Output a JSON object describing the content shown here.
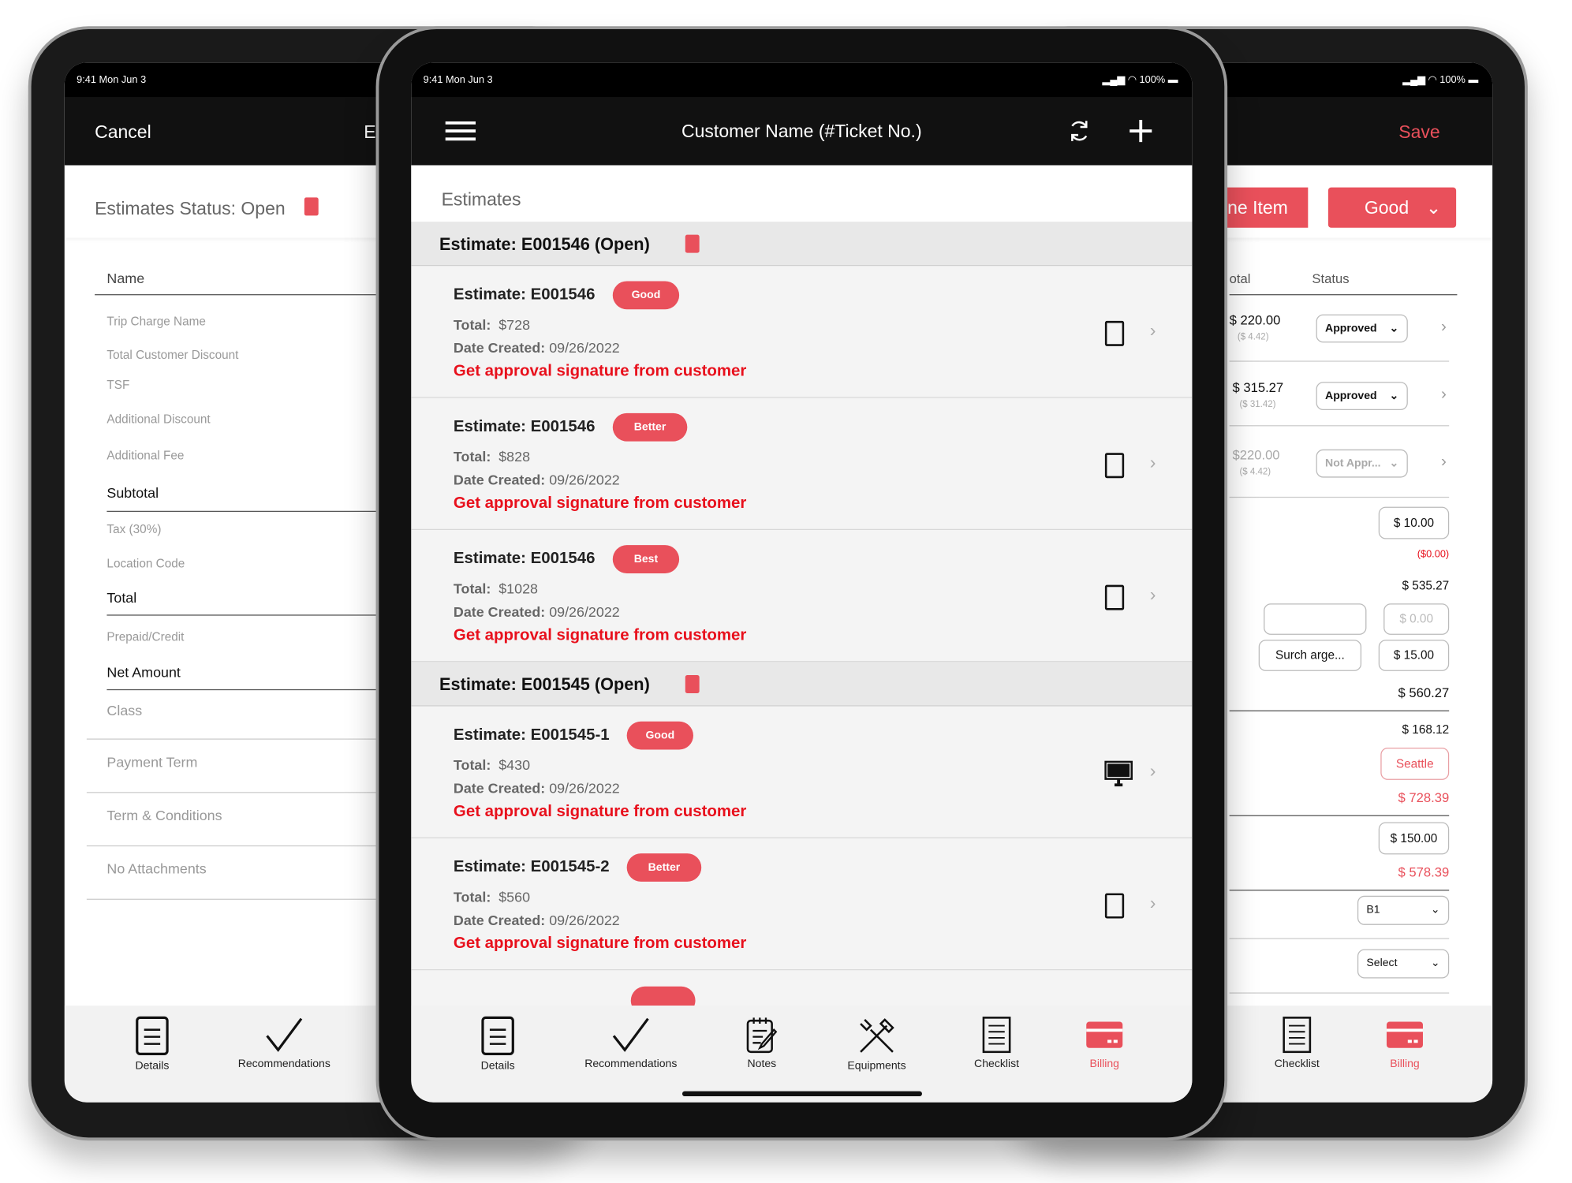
{
  "status_bar": {
    "time": "9:41 Mon Jun 3",
    "battery": "100%"
  },
  "left": {
    "cancel": "Cancel",
    "title_partial": "E",
    "status": "Estimates Status: Open",
    "fields": [
      "Name",
      "Trip Charge Name",
      "Total Customer Discount",
      "TSF",
      "Additional Discount",
      "Additional Fee",
      "Subtotal",
      "Tax (30%)",
      "Location Code",
      "Total",
      "Prepaid/Credit",
      "Net Amount",
      "Class",
      "Payment Term",
      "Term & Conditions",
      "No Attachments"
    ],
    "tabs": [
      "Details",
      "Recommendations"
    ]
  },
  "center": {
    "title": "Customer Name (#Ticket No.)",
    "heading": "Estimates",
    "sections": [
      {
        "title": "Estimate: E001546  (Open)",
        "items": [
          {
            "name": "Estimate: E001546",
            "badge": "Good",
            "total_label": "Total:",
            "total": "$728",
            "date_label": "Date Created:",
            "date": "09/26/2022",
            "action": "Get approval signature from customer",
            "device": "tablet"
          },
          {
            "name": "Estimate: E001546",
            "badge": "Better",
            "total_label": "Total:",
            "total": "$828",
            "date_label": "Date Created:",
            "date": "09/26/2022",
            "action": "Get approval signature from customer",
            "device": "tablet"
          },
          {
            "name": "Estimate: E001546",
            "badge": "Best",
            "total_label": "Total:",
            "total": "$1028",
            "date_label": "Date Created:",
            "date": "09/26/2022",
            "action": "Get approval signature from customer",
            "device": "tablet"
          }
        ]
      },
      {
        "title": "Estimate: E001545  (Open)",
        "items": [
          {
            "name": "Estimate: E001545-1",
            "badge": "Good",
            "total_label": "Total:",
            "total": "$430",
            "date_label": "Date Created:",
            "date": "09/26/2022",
            "action": "Get approval signature from customer",
            "device": "desktop"
          },
          {
            "name": "Estimate: E001545-2",
            "badge": "Better",
            "total_label": "Total:",
            "total": "$560",
            "date_label": "Date Created:",
            "date": "09/26/2022",
            "action": "Get approval signature from customer",
            "device": "tablet"
          }
        ]
      }
    ],
    "tabs": [
      "Details",
      "Recommendations",
      "Notes",
      "Equipments",
      "Checklist",
      "Billing"
    ],
    "active_tab": "Billing"
  },
  "right": {
    "save": "Save",
    "line_item_partial": "ne Item",
    "tier_select": "Good",
    "col_total_partial": "otal",
    "col_status": "Status",
    "rows": [
      {
        "amount": "$ 220.00",
        "tax": "($ 4.42)",
        "status": "Approved"
      },
      {
        "amount": "$ 315.27",
        "tax": "($ 31.42)",
        "status": "Approved"
      },
      {
        "amount": "$220.00",
        "tax": "($ 4.42)",
        "status": "Not Appr..."
      }
    ],
    "values": {
      "fee": "$ 10.00",
      "discount": "($0.00)",
      "subtotal": "$ 535.27",
      "tax_placeholder": "$ 0.00",
      "surcharge": "Surch arge...",
      "surcharge_amount": "$ 15.00",
      "total": "$ 560.27",
      "tax_total": "$ 168.12",
      "location": "Seattle",
      "grand": "$ 728.39",
      "prepaid": "$ 150.00",
      "net": "$ 578.39",
      "class": "B1",
      "payment_term": "Select"
    },
    "tabs": [
      "Checklist",
      "Billing"
    ]
  },
  "colors": {
    "accent": "#e9505b",
    "alert": "#e8101c",
    "nav": "#111111"
  }
}
